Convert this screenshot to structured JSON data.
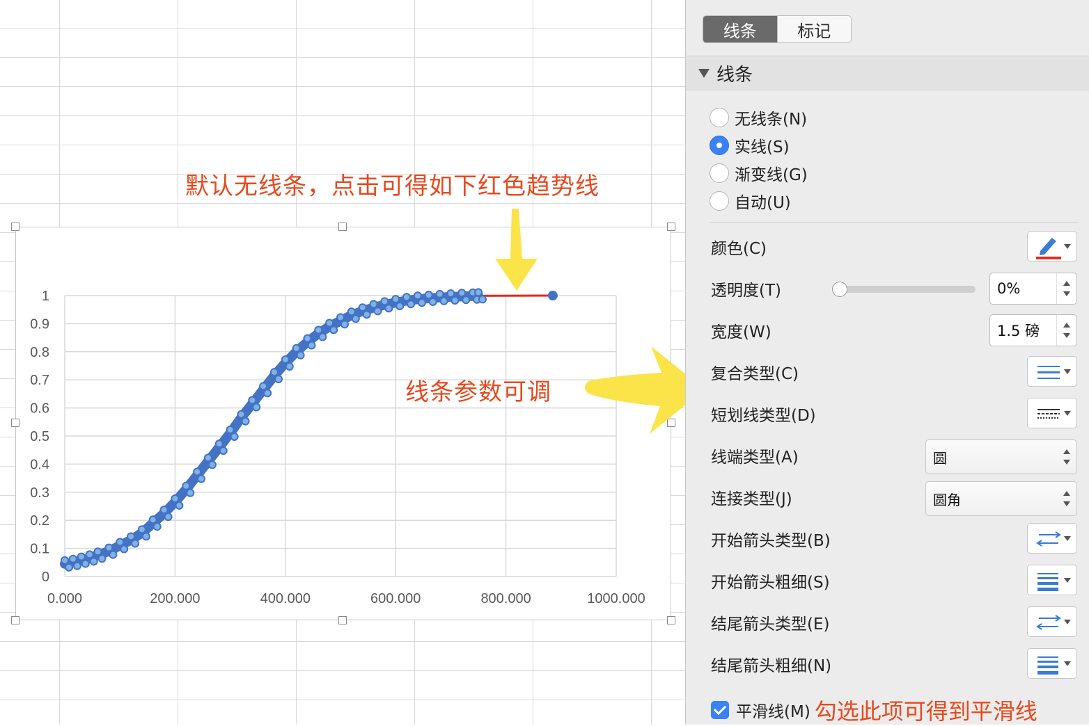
{
  "annotations": {
    "top": "默认无线条，点击可得如下红色趋势线",
    "middle": "线条参数可调"
  },
  "panel": {
    "tabs": [
      {
        "label": "线条",
        "active": true
      },
      {
        "label": "标记",
        "active": false
      }
    ],
    "section_title": "线条",
    "line_type_options": [
      {
        "label": "无线条(N)",
        "checked": false
      },
      {
        "label": "实线(S)",
        "checked": true
      },
      {
        "label": "渐变线(G)",
        "checked": false
      },
      {
        "label": "自动(U)",
        "checked": false
      }
    ],
    "color": {
      "label": "颜色(C)",
      "value_color": "#e8291c",
      "icon": "pencil-icon"
    },
    "transparency": {
      "label": "透明度(T)",
      "value": "0%",
      "slider_fraction": 0
    },
    "width": {
      "label": "宽度(W)",
      "value": "1.5 磅"
    },
    "compound_type": {
      "label": "复合类型(C)",
      "icon": "compound-lines-icon"
    },
    "dash_type": {
      "label": "短划线类型(D)",
      "icon": "dash-lines-icon"
    },
    "cap_type": {
      "label": "线端类型(A)",
      "value": "圆"
    },
    "join_type": {
      "label": "连接类型(J)",
      "value": "圆角"
    },
    "begin_arrow_type": {
      "label": "开始箭头类型(B)",
      "icon": "arrow-type-icon"
    },
    "begin_arrow_size": {
      "label": "开始箭头粗细(S)",
      "icon": "arrow-size-icon"
    },
    "end_arrow_type": {
      "label": "结尾箭头类型(E)",
      "icon": "arrow-type-icon"
    },
    "end_arrow_size": {
      "label": "结尾箭头粗细(N)",
      "icon": "arrow-size-icon"
    },
    "smooth_line": {
      "label": "平滑线(M)",
      "checked": true,
      "annotation": "勾选此项可得到平滑线"
    }
  },
  "colors": {
    "series": "#4472c4",
    "trendline": "#e8291c",
    "annotation": "#e8491d",
    "arrow": "#fbe44a"
  },
  "chart_data": {
    "type": "scatter",
    "xlim": [
      0,
      1000
    ],
    "ylim": [
      0,
      1
    ],
    "x_ticks": [
      "0.000",
      "200.000",
      "400.000",
      "600.000",
      "800.000",
      "1000.000"
    ],
    "y_ticks": [
      "0",
      "0.1",
      "0.2",
      "0.3",
      "0.4",
      "0.5",
      "0.6",
      "0.7",
      "0.8",
      "0.9",
      "1"
    ],
    "grid": true,
    "series": [
      {
        "x": [
          0,
          15,
          30,
          45,
          60,
          80,
          100,
          120,
          140,
          160,
          180,
          200,
          220,
          240,
          260,
          280,
          300,
          320,
          340,
          360,
          380,
          400,
          420,
          440,
          460,
          480,
          500,
          520,
          540,
          560,
          580,
          600,
          620,
          640,
          660,
          680,
          700,
          720,
          740,
          750
        ],
        "y": [
          0.045,
          0.05,
          0.058,
          0.066,
          0.076,
          0.09,
          0.11,
          0.13,
          0.155,
          0.19,
          0.225,
          0.265,
          0.31,
          0.36,
          0.41,
          0.46,
          0.51,
          0.565,
          0.615,
          0.665,
          0.715,
          0.76,
          0.8,
          0.835,
          0.865,
          0.89,
          0.91,
          0.93,
          0.945,
          0.957,
          0.967,
          0.975,
          0.982,
          0.987,
          0.99,
          0.993,
          0.995,
          0.997,
          0.998,
          0.999
        ]
      }
    ],
    "trendline": {
      "x": [
        750,
        885
      ],
      "y": [
        0.999,
        1.0
      ]
    },
    "endpoint": {
      "x": 885,
      "y": 1.0
    }
  }
}
